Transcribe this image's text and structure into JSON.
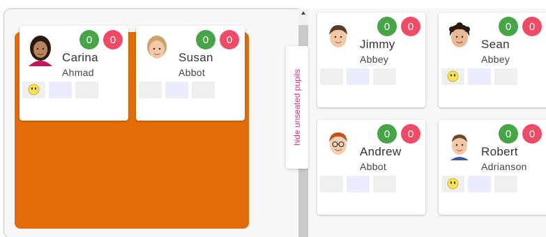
{
  "panel": {
    "hide_unseated_label": "hide unseated pupils"
  },
  "colors": {
    "table": "#e36c0a",
    "green_badge": "#47a447",
    "red_badge": "#ef4b66",
    "toggle_text": "#d63384"
  },
  "seated_pupils": [
    {
      "first_name": "Carina",
      "last_name": "Ahmad",
      "positive": "0",
      "negative": "0",
      "avatar_icon": "student-girl-dark-hair-icon",
      "has_smiley": true
    },
    {
      "first_name": "Susan",
      "last_name": "Abbot",
      "positive": "0",
      "negative": "0",
      "avatar_icon": "student-girl-blonde-icon",
      "has_smiley": false
    }
  ],
  "unseated_pupils": [
    {
      "first_name": "Jimmy",
      "last_name": "Abbey",
      "positive": "0",
      "negative": "0",
      "avatar_icon": "student-boy-brown-hair-icon",
      "has_smiley": false
    },
    {
      "first_name": "Sean",
      "last_name": "Abbey",
      "positive": "0",
      "negative": "0",
      "avatar_icon": "student-boy-curly-hair-icon",
      "has_smiley": true
    },
    {
      "first_name": "Andrew",
      "last_name": "Abbot",
      "positive": "0",
      "negative": "0",
      "avatar_icon": "student-boy-red-hair-glasses-icon",
      "has_smiley": false
    },
    {
      "first_name": "Robert",
      "last_name": "Adrianson",
      "positive": "0",
      "negative": "0",
      "avatar_icon": "student-boy-short-hair-icon",
      "has_smiley": true
    }
  ]
}
